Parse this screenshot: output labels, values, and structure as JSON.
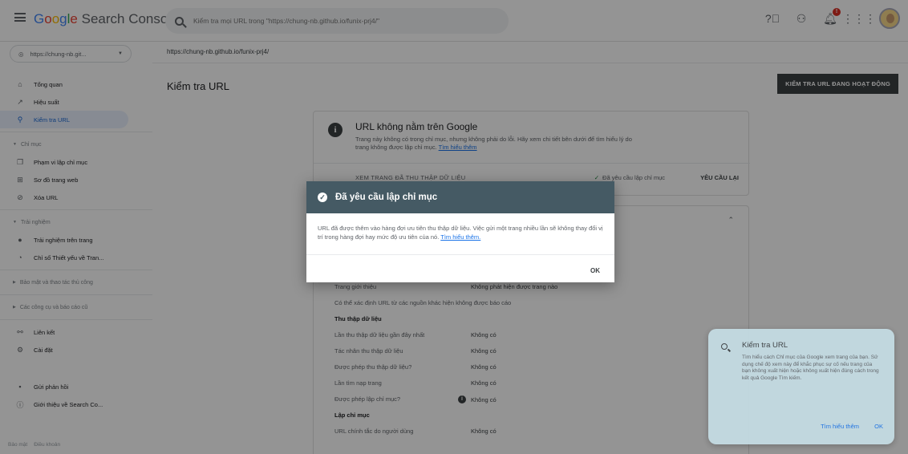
{
  "app": {
    "logo_google": [
      "G",
      "o",
      "o",
      "g",
      "l",
      "e"
    ],
    "logo_rest": " Search Console"
  },
  "search": {
    "placeholder": "Kiểm tra mọi URL trong \"https://chung-nb.github.io/funix-prj4/\""
  },
  "topbar": {
    "icons": [
      "help-icon",
      "users-icon",
      "notifications-icon",
      "apps-icon",
      "avatar"
    ],
    "notification_count": "!"
  },
  "property": {
    "label": "https://chung-nb.git...",
    "icon": "globe-icon"
  },
  "sidebar": {
    "items": [
      {
        "label": "Tổng quan",
        "icon": "home-icon",
        "glyph": "⌂"
      },
      {
        "label": "Hiệu suất",
        "icon": "trend-icon",
        "glyph": "↗"
      },
      {
        "label": "Kiểm tra URL",
        "icon": "search-icon",
        "glyph": "⚲"
      }
    ],
    "section_index": {
      "title": "Chỉ mục"
    },
    "index_items": [
      {
        "label": "Phạm vi lập chỉ mục",
        "icon": "coverage-icon",
        "glyph": "❐"
      },
      {
        "label": "Sơ đồ trang web",
        "icon": "sitemap-icon",
        "glyph": "⊞"
      },
      {
        "label": "Xóa URL",
        "icon": "removal-icon",
        "glyph": "⊘"
      }
    ],
    "section_experience": {
      "title": "Trải nghiệm"
    },
    "experience_items": [
      {
        "label": "Trải nghiệm trên trang",
        "icon": "page-experience-icon",
        "glyph": "●"
      },
      {
        "label": "Chỉ số Thiết yếu về Tran...",
        "icon": "web-vitals-icon",
        "glyph": "◔"
      }
    ],
    "section_security": {
      "title": "Bảo mật và thao tác thủ công"
    },
    "section_legacy": {
      "title": "Các công cụ và báo cáo cũ"
    },
    "bottom_items": [
      {
        "label": "Liên kết",
        "icon": "links-icon",
        "glyph": "⚯"
      },
      {
        "label": "Cài đặt",
        "icon": "settings-icon",
        "glyph": "⚙"
      }
    ],
    "footer_items": [
      {
        "label": "Gửi phản hồi",
        "icon": "feedback-icon",
        "glyph": "▪"
      },
      {
        "label": "Giới thiệu về Search Co...",
        "icon": "info-icon",
        "glyph": "ⓘ"
      }
    ],
    "footer_links": [
      "Bảo mật",
      "Điều khoản"
    ]
  },
  "main": {
    "breadcrumb": "https://chung-nb.github.io/funix-prj4/",
    "title": "Kiểm tra URL",
    "live_button": "KIỂM TRA URL ĐANG HOẠT ĐỘNG"
  },
  "status_card": {
    "heading": "URL không nằm trên Google",
    "desc": "Trang này không có trong chỉ mục, nhưng không phải do lỗi. Hãy xem chi tiết bên dưới để tìm hiểu lý do trang không được lập chỉ mục.",
    "desc_link": "Tìm hiểu thêm",
    "fetch_link": "XEM TRANG ĐÃ THU THẬP DỮ LIỆU",
    "request_status": "Đã yêu cầu lập chỉ mục",
    "request_again": "YÊU CẦU LẠI"
  },
  "details": {
    "rows_top": [
      {
        "k": "Trang giới thiệu",
        "v": "Không phát hiện được trang nào"
      }
    ],
    "note": "Có thể xác định URL từ các nguồn khác hiện không được báo cáo",
    "crawl_heading": "Thu thập dữ liệu",
    "crawl_rows": [
      {
        "k": "Lần thu thập dữ liệu gần đây nhất",
        "v": "Không có"
      },
      {
        "k": "Tác nhân thu thập dữ liệu",
        "v": "Không có"
      },
      {
        "k": "Được phép thu thập dữ liệu?",
        "v": "Không có"
      },
      {
        "k": "Lần tìm nạp trang",
        "v": "Không có"
      },
      {
        "k": "Được phép lập chỉ mục?",
        "v": "Không có"
      }
    ],
    "index_heading": "Lập chỉ mục",
    "index_rows": [
      {
        "k": "URL chính tắc do người dùng",
        "v": "Không có"
      }
    ]
  },
  "dialog": {
    "title": "Đã yêu cầu lập chỉ mục",
    "body": "URL đã được thêm vào hàng đợi ưu tiên thu thập dữ liệu. Việc gửi một trang nhiều lần sẽ không thay đổi vị trí trong hàng đợi hay mức độ ưu tiên của nó.",
    "link": "Tìm hiểu thêm.",
    "ok": "OK"
  },
  "help_panel": {
    "title": "Kiểm tra URL",
    "desc": "Tìm hiểu cách Chỉ mục của Google xem trang của bạn. Sử dụng chế độ xem này để khắc phục sự cố nếu trang của bạn không xuất hiện hoặc không xuất hiện đúng cách trong kết quả Google Tìm kiếm.",
    "learn_more": "Tìm hiểu thêm",
    "ok": "OK"
  }
}
